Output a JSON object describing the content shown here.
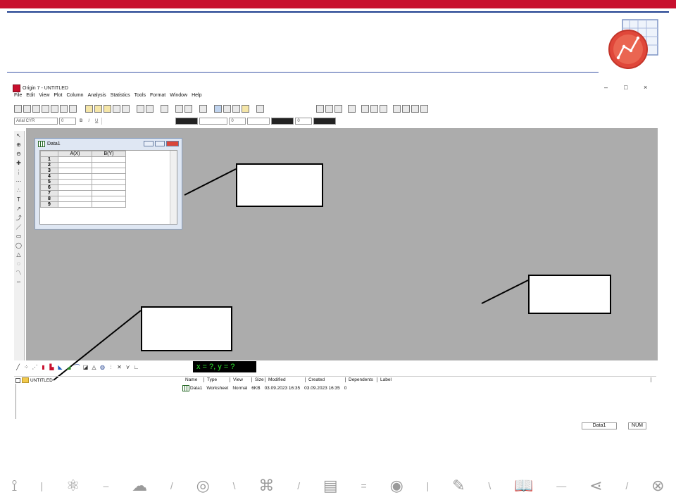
{
  "window": {
    "title": "Origin 7 - UNTITLED",
    "controls": [
      "–",
      "□",
      "×"
    ]
  },
  "menu": [
    "File",
    "Edit",
    "View",
    "Plot",
    "Column",
    "Analysis",
    "Statistics",
    "Tools",
    "Format",
    "Window",
    "Help"
  ],
  "format_bar": {
    "font": "Arial CYR",
    "size": "0",
    "bold": "B",
    "italic": "I",
    "underline": "U",
    "line_width": "0",
    "fill_width": "0"
  },
  "worksheet": {
    "title": "Data1",
    "columns": [
      "A(X)",
      "B(Y)"
    ],
    "rows": [
      "1",
      "2",
      "3",
      "4",
      "5",
      "6",
      "7",
      "8",
      "9"
    ]
  },
  "coordinates": "x = ?, y = ?",
  "project": {
    "root": "UNTITLED",
    "headers": [
      "Name",
      "Type",
      "View",
      "Size",
      "Modified",
      "Created",
      "Dependents",
      "Label"
    ],
    "items": [
      {
        "name": "Data1",
        "type": "Worksheet",
        "view": "Normal",
        "size": "6KB",
        "modified": "03.09.2023 16:35",
        "created": "03.09.2023 16:35",
        "dependents": "0"
      }
    ]
  },
  "status": {
    "window": "Data1",
    "num": "NUM"
  },
  "colors": {
    "brand_red": "#c8102e",
    "brand_blue": "#1f3f8f",
    "workspace": "#acacac",
    "coord_text": "#2ee62e"
  },
  "icons": [
    "origin-logo-icon",
    "worksheet-icon",
    "folder-icon"
  ]
}
